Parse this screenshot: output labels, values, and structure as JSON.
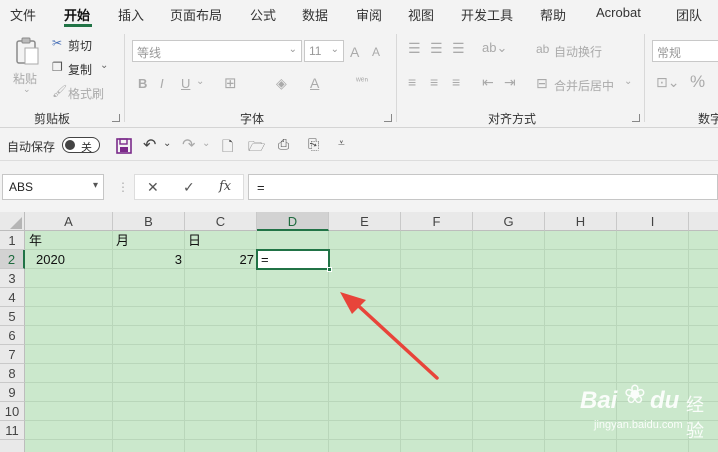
{
  "menu_tabs": [
    "文件",
    "开始",
    "插入",
    "页面布局",
    "公式",
    "数据",
    "审阅",
    "视图",
    "开发工具",
    "帮助",
    "Acrobat",
    "团队"
  ],
  "active_tab": "开始",
  "ribbon": {
    "clipboard": {
      "paste": "粘贴",
      "cut": "剪切",
      "copy": "复制",
      "format_painter": "格式刷",
      "label": "剪贴板"
    },
    "font": {
      "font_name": "等线",
      "font_size": "11",
      "bold": "B",
      "italic": "I",
      "underline": "U",
      "grow": "A",
      "shrink": "A",
      "font_color": "A",
      "label": "字体"
    },
    "alignment": {
      "wrap": "自动换行",
      "merge": "合并后居中",
      "label": "对齐方式"
    },
    "number": {
      "format": "常规",
      "percent": "%",
      "label": "数字"
    }
  },
  "qat": {
    "autosave_label": "自动保存",
    "autosave_state": "关"
  },
  "formula_bar": {
    "name_box": "ABS",
    "cancel": "✕",
    "enter": "✓",
    "fx": "fx",
    "formula": "="
  },
  "sheet": {
    "columns": [
      "A",
      "B",
      "C",
      "D",
      "E",
      "F",
      "G",
      "H",
      "I"
    ],
    "rows": [
      "1",
      "2",
      "3",
      "4",
      "5",
      "6",
      "7",
      "8",
      "9",
      "10",
      "11"
    ],
    "row1": {
      "A": "年",
      "B": "月",
      "C": "日"
    },
    "row2": {
      "A": "2020",
      "B": "3",
      "C": "27",
      "D": "="
    },
    "selected_column": "D",
    "selected_row": "2"
  },
  "watermark": {
    "brand": "Bai",
    "brand2": "du",
    "cn": "经验",
    "url": "jingyan.baidu.com"
  },
  "colors": {
    "accent": "#217346",
    "sheet_bg": "#cbe8cc",
    "arrow": "#e8443a"
  }
}
